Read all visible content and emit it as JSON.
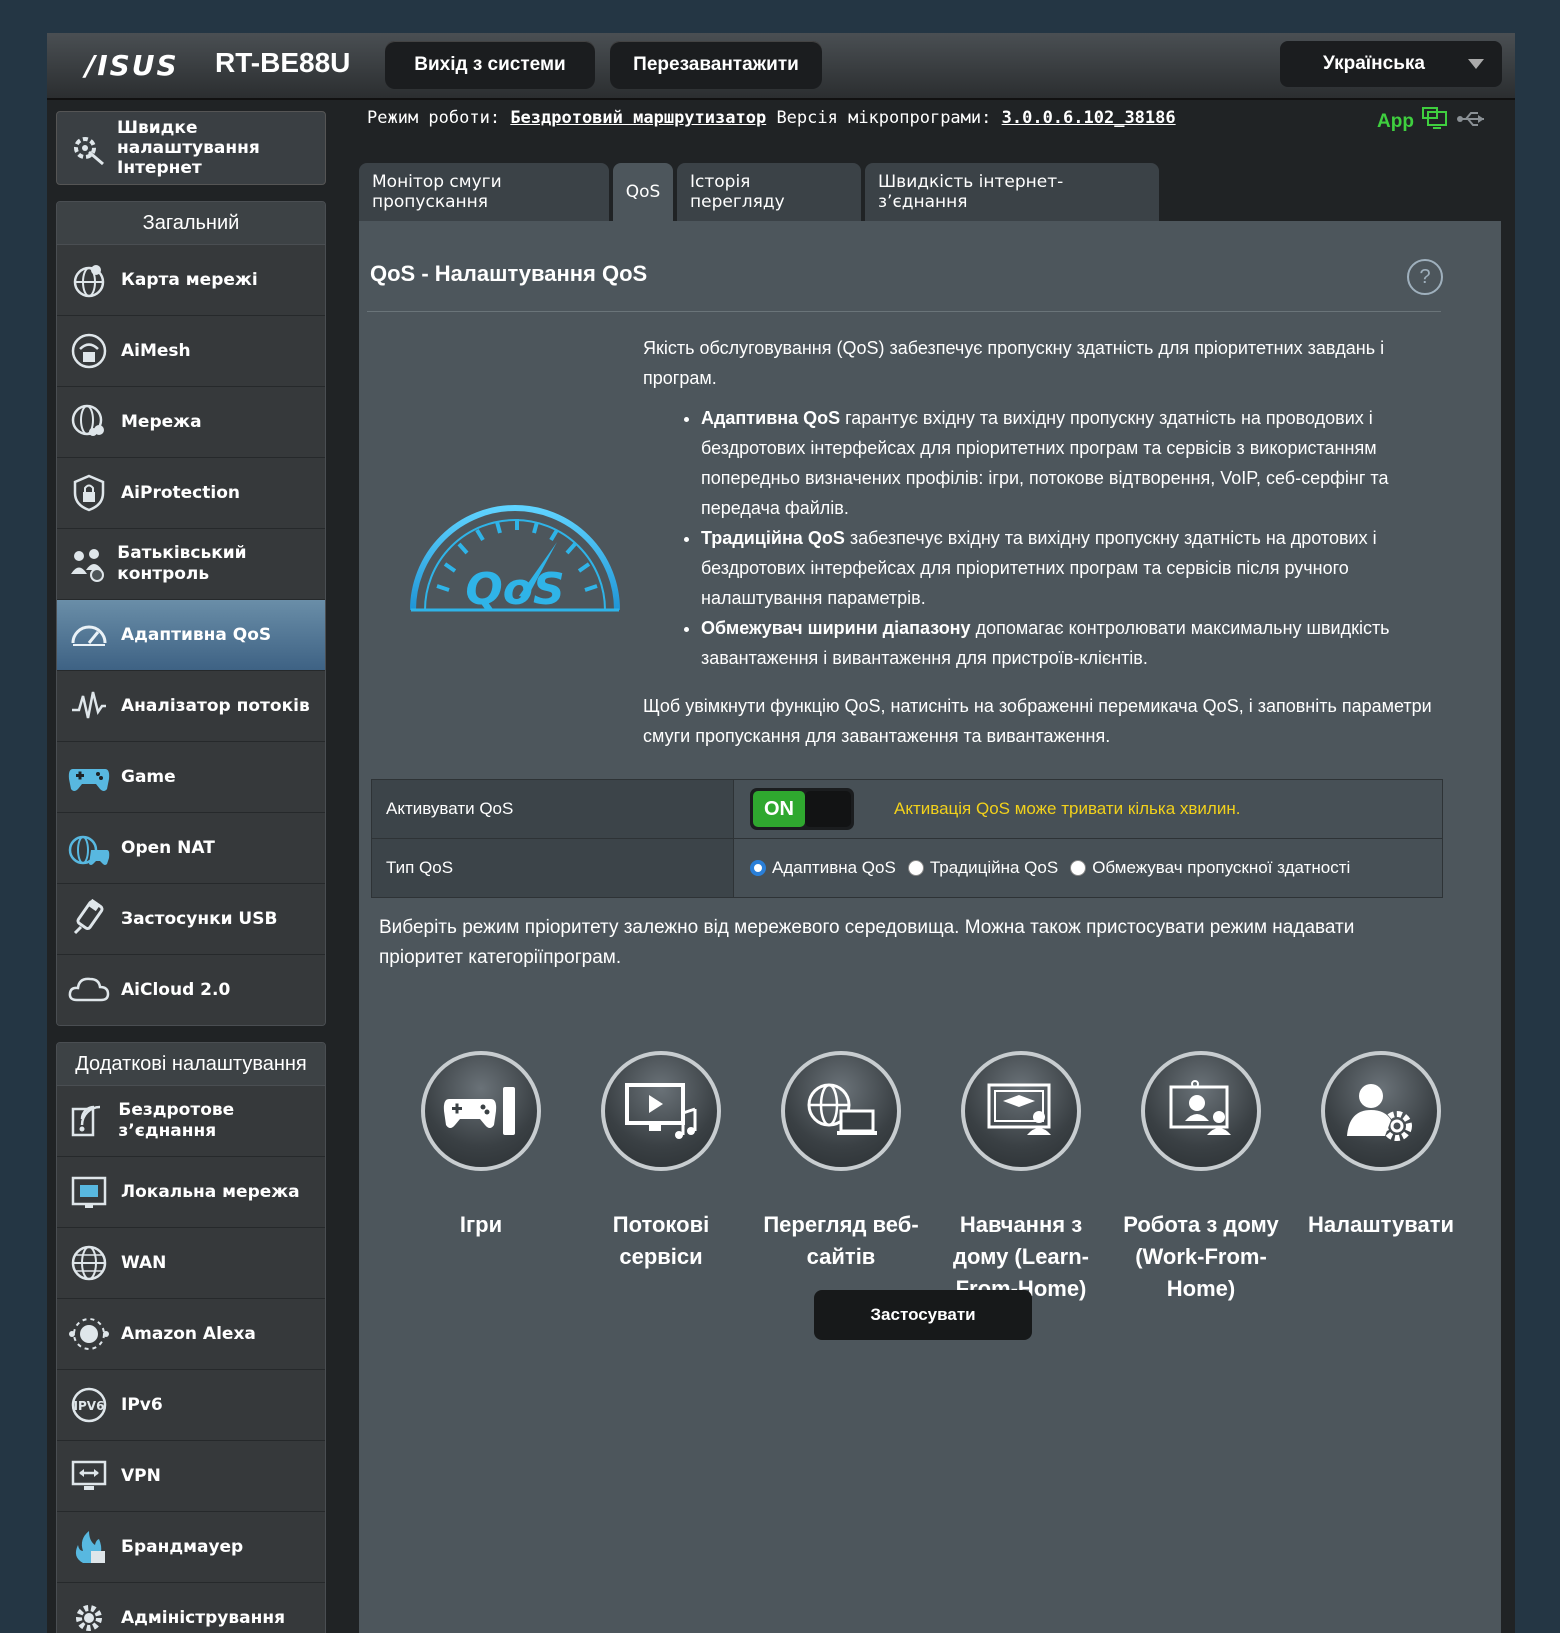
{
  "header": {
    "logo": "/ISUS",
    "model": "RT-BE88U",
    "logout_label": "Вихід з системи",
    "reboot_label": "Перезавантажити",
    "language": "Українська"
  },
  "status": {
    "mode_label": "Режим роботи:",
    "mode_value": "Бездротовий маршрутизатор",
    "fw_label": "Версія мікропрограми:",
    "fw_value": "3.0.0.6.102_38186",
    "app_label": "App"
  },
  "sidebar": {
    "quick_label": "Швидке налаштування Інтернет",
    "general_title": "Загальний",
    "general_items": [
      {
        "label": "Карта мережі",
        "icon": "network-map-icon"
      },
      {
        "label": "AiMesh",
        "icon": "aimesh-icon"
      },
      {
        "label": "Мережа",
        "icon": "guest-network-icon"
      },
      {
        "label": "AiProtection",
        "icon": "shield-icon"
      },
      {
        "label": "Батьківський контроль",
        "icon": "parental-control-icon"
      },
      {
        "label": "Адаптивна QoS",
        "icon": "qos-gauge-icon"
      },
      {
        "label": "Аналізатор потоків",
        "icon": "traffic-analyzer-icon"
      },
      {
        "label": "Game",
        "icon": "gamepad-icon"
      },
      {
        "label": "Open NAT",
        "icon": "open-nat-icon"
      },
      {
        "label": "Застосунки USB",
        "icon": "usb-icon"
      },
      {
        "label": "AiCloud 2.0",
        "icon": "cloud-icon"
      }
    ],
    "advanced_title": "Додаткові налаштування",
    "advanced_items": [
      {
        "label": "Бездротове з’єднання",
        "icon": "wireless-icon"
      },
      {
        "label": "Локальна мережа",
        "icon": "lan-icon"
      },
      {
        "label": "WAN",
        "icon": "globe-icon"
      },
      {
        "label": "Amazon Alexa",
        "icon": "alexa-icon"
      },
      {
        "label": "IPv6",
        "icon": "ipv6-icon"
      },
      {
        "label": "VPN",
        "icon": "vpn-icon"
      },
      {
        "label": "Брандмауер",
        "icon": "firewall-icon"
      },
      {
        "label": "Адміністрування",
        "icon": "admin-gear-icon"
      }
    ]
  },
  "tabs": [
    "Монітор смуги пропускання",
    "QoS",
    "Історія перегляду",
    "Швидкість інтернет-з’єднання"
  ],
  "main": {
    "title": "QoS - Налаштування QoS",
    "help": "?",
    "gauge_text": "QoS",
    "intro": "Якість обслуговування (QoS) забезпечує пропускну здатність для пріоритетних завдань і програм.",
    "bullets": [
      {
        "bold": "Адаптивна QoS",
        "text": " гарантує вхідну та вихідну пропускну здатність на проводових і бездротових інтерфейсах для пріоритетних програм та сервісів з використанням попередньо визначених профілів: ігри, потокове відтворення, VoIP, себ-серфінг та передача файлів."
      },
      {
        "bold": "Традиційна QoS",
        "text": " забезпечує вхідну та вихідну пропускну здатність на дротових і бездротових інтерфейсах для пріоритетних програм та сервісів після ручного налаштування параметрів."
      },
      {
        "bold": "Обмежувач ширини діапазону",
        "text": " допомагає контролювати максимальну швидкість завантаження і вивантаження для пристроїв-клієнтів."
      }
    ],
    "outro": "Щоб увімкнути функцію QoS, натисніть на зображенні перемикача QoS, і заповніть параметри смуги пропускання для завантаження та вивантаження.",
    "enable_label": "Активувати QoS",
    "toggle_on": "ON",
    "enable_warning": "Активація QoS може тривати кілька хвилин.",
    "type_label": "Тип QoS",
    "type_options": [
      "Адаптивна QoS",
      "Традиційна QoS",
      "Обмежувач пропускної здатності"
    ],
    "type_selected": "Адаптивна QoS",
    "prompt": "Виберіть режим пріоритету залежно від мережевого середовища. Можна також пристосувати режим надавати пріоритет категоріїпрограм.",
    "modes": [
      {
        "label": "Ігри",
        "icon": "gaming-icon"
      },
      {
        "label": "Потокові сервіси",
        "icon": "streaming-icon"
      },
      {
        "label": "Перегляд веб-сайтів",
        "icon": "web-surfing-icon"
      },
      {
        "label": "Навчання з дому (Learn-From-Home)",
        "icon": "learn-from-home-icon"
      },
      {
        "label": "Робота з дому (Work-From-Home)",
        "icon": "work-from-home-icon"
      },
      {
        "label": "Налаштувати",
        "icon": "customize-icon"
      }
    ],
    "apply_label": "Застосувати"
  },
  "colors": {
    "accent": "#3e6284",
    "status_ok": "#2fa82f",
    "warning": "#f2d11b",
    "app_green": "#3fcf3f",
    "qos_logo": "#2fb4e8"
  }
}
